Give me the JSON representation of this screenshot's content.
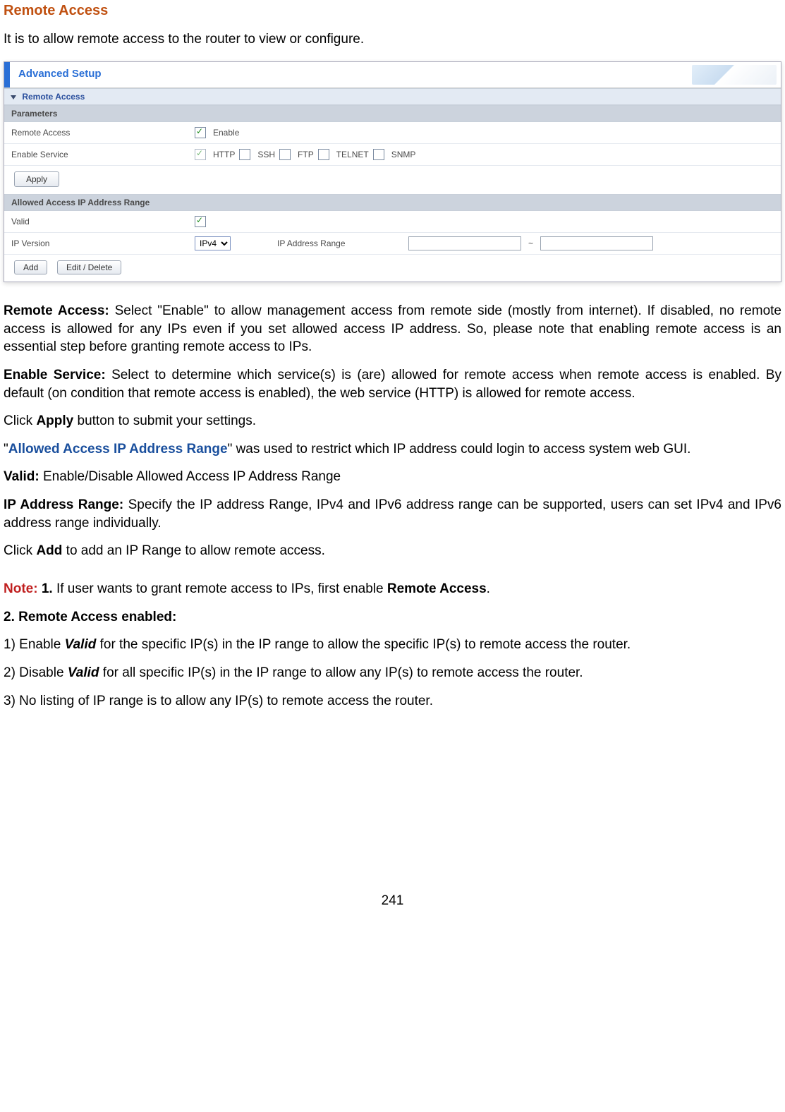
{
  "title": "Remote Access",
  "intro": "It is to allow remote access to the router to view or configure.",
  "panel": {
    "header": "Advanced Setup",
    "sections": {
      "remote_access": "Remote Access",
      "parameters": "Parameters",
      "allowed_range": "Allowed Access IP Address Range"
    },
    "rows": {
      "remote_access_label": "Remote Access",
      "enable_label": "Enable",
      "enable_service_label": "Enable Service",
      "services": [
        "HTTP",
        "SSH",
        "FTP",
        "TELNET",
        "SNMP"
      ],
      "apply": "Apply",
      "valid_label": "Valid",
      "ip_version_label": "IP Version",
      "ip_version_value": "IPv4",
      "ip_range_label": "IP Address Range",
      "add": "Add",
      "edit_delete": "Edit / Delete"
    }
  },
  "para1_strong": "Remote Access:",
  "para1_rest": " Select \"Enable\" to allow management access from remote side (mostly from internet). If disabled, no remote access is allowed for any IPs even if you set allowed access IP address. So, please note that enabling remote access is an essential step before granting remote access to IPs.",
  "para2_strong": "Enable Service:",
  "para2_rest": " Select to determine which service(s) is (are) allowed for remote access when remote access is enabled. By default (on condition that remote access is enabled), the web service (HTTP) is allowed for remote access.",
  "para3_pre": "Click ",
  "para3_strong": "Apply",
  "para3_post": " button to submit your settings.",
  "para4_q1": "\"",
  "para4_blue": "Allowed Access IP Address Range",
  "para4_rest": "\" was used to restrict which IP address could login to access system web GUI.",
  "para5_strong": "Valid:",
  "para5_rest": " Enable/Disable Allowed Access IP Address Range",
  "para6_strong": "IP Address Range:",
  "para6_rest": " Specify the IP address Range, IPv4 and IPv6 address range can be supported, users can set IPv4 and IPv6 address range individually.",
  "para7_pre": "Click ",
  "para7_strong": "Add",
  "para7_post": " to add an IP Range to allow remote access.",
  "note_label": "Note:",
  "note1_num": " 1.",
  "note1_rest_pre": " If user wants to grant remote access to IPs, first enable ",
  "note1_rest_bold": "Remote Access",
  "note1_rest_post": ".",
  "note2": "2. Remote Access enabled:",
  "note2_1_pre": "1) Enable ",
  "note2_1_ital": "Valid",
  "note2_1_post": " for the specific IP(s) in the IP range to allow the specific IP(s) to remote access the router.",
  "note2_2_pre": "2) Disable ",
  "note2_2_ital": "Valid",
  "note2_2_post": " for all specific IP(s) in the IP range to allow any IP(s) to remote access the router.",
  "note2_3": "3) No listing of IP range is to allow any IP(s) to remote access the router.",
  "page_number": "241"
}
